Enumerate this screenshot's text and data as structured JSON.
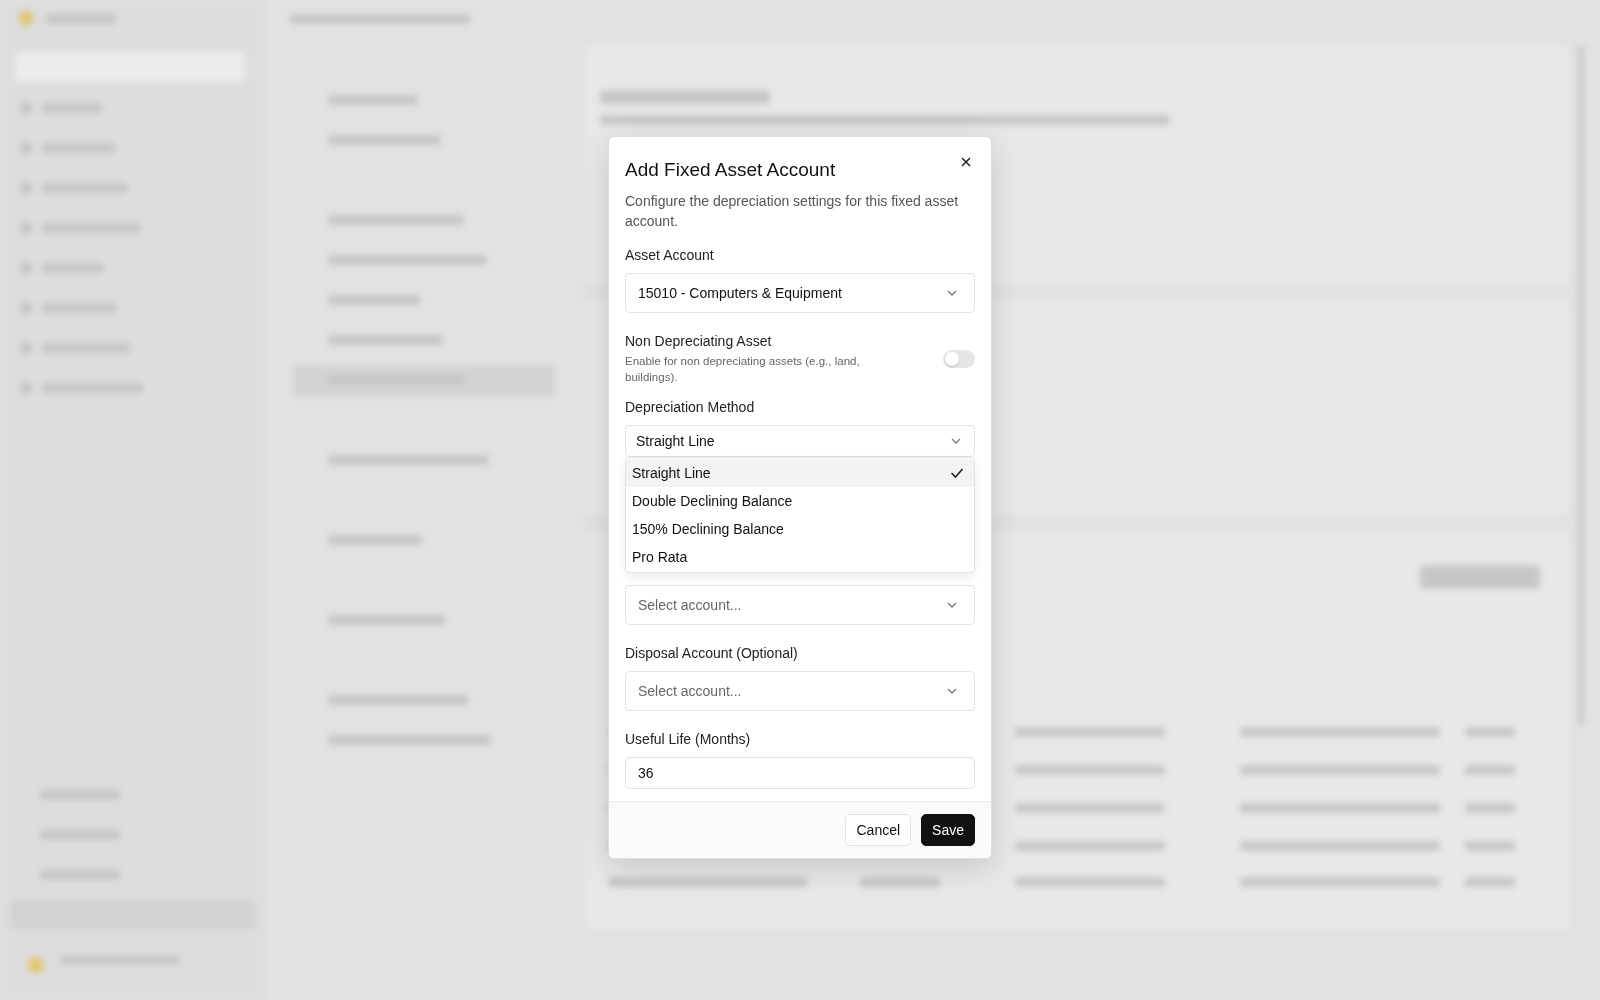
{
  "dialog": {
    "title": "Add Fixed Asset Account",
    "description": "Configure the depreciation settings for this fixed asset account.",
    "asset_account": {
      "label": "Asset Account",
      "value": "15010 - Computers & Equipment"
    },
    "non_depreciating": {
      "label": "Non Depreciating Asset",
      "hint": "Enable for non depreciating assets (e.g., land, buildings).",
      "on": false
    },
    "depreciation_method": {
      "label": "Depreciation Method",
      "value": "Straight Line",
      "expanded": true,
      "options": [
        {
          "label": "Straight Line",
          "selected": true
        },
        {
          "label": "Double Declining Balance",
          "selected": false
        },
        {
          "label": "150% Declining Balance",
          "selected": false
        },
        {
          "label": "Pro Rata",
          "selected": false
        }
      ]
    },
    "accumulated_account": {
      "placeholder": "Select account..."
    },
    "disposal_account": {
      "label": "Disposal Account (Optional)",
      "placeholder": "Select account..."
    },
    "useful_life": {
      "label": "Useful Life (Months)",
      "value": "36"
    },
    "buttons": [
      {
        "label": "Cancel",
        "kind": "secondary"
      },
      {
        "label": "Save",
        "kind": "primary"
      }
    ]
  }
}
